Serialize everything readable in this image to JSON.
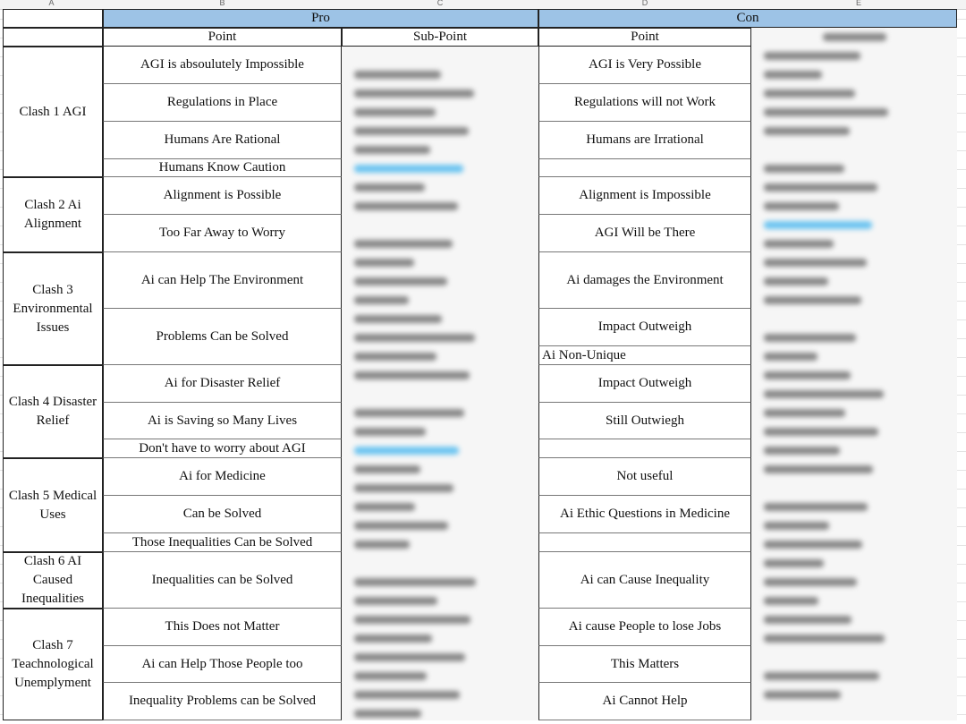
{
  "sheet": {
    "column_letters": [
      "A",
      "B",
      "C",
      "D",
      "E"
    ],
    "pro_label": "Pro",
    "con_label": "Con",
    "pro_point_header": "Point",
    "pro_subpoint_header": "Sub-Point",
    "con_point_header": "Point",
    "band_color": "#9dc3e6",
    "clashes": [
      "Clash 1 AGI",
      "Clash 2 Ai Alignment",
      "Clash 3 Environmental Issues",
      "Clash 4 Disaster Relief",
      "Clash 5 Medical Uses",
      "Clash 6 AI Caused Inequalities",
      "Clash 7 Teachnological Unemplyment"
    ],
    "pro_points": [
      "AGI is absoulutely Impossible",
      "Regulations in Place",
      "Humans Are Rational",
      "Humans Know Caution",
      "Alignment is Possible",
      "Too Far Away to Worry",
      "Ai can Help The Environment",
      "Problems Can be Solved",
      "Ai for Disaster Relief",
      "Ai is Saving so Many Lives",
      "Don't have to worry about AGI",
      "Ai for Medicine",
      "Can be Solved",
      "Those Inequalities Can be Solved",
      "Inequalities can be Solved",
      "This Does not Matter",
      "Ai can Help Those People too",
      "Inequality Problems can be Solved"
    ],
    "con_points": [
      "AGI is Very Possible",
      "Regulations will not Work",
      "Humans are Irrational",
      "",
      "Alignment is Impossible",
      "AGI Will be There",
      "Ai damages the Environment",
      "Impact Outweigh",
      "Ai Non-Unique",
      "Impact Outweigh",
      "Still Outwiegh",
      "",
      "Not useful",
      "Ai Ethic Questions in Medicine",
      "",
      "Ai can Cause Inequality",
      "Ai cause People to lose Jobs",
      "This Matters",
      "Ai Cannot Help"
    ]
  }
}
